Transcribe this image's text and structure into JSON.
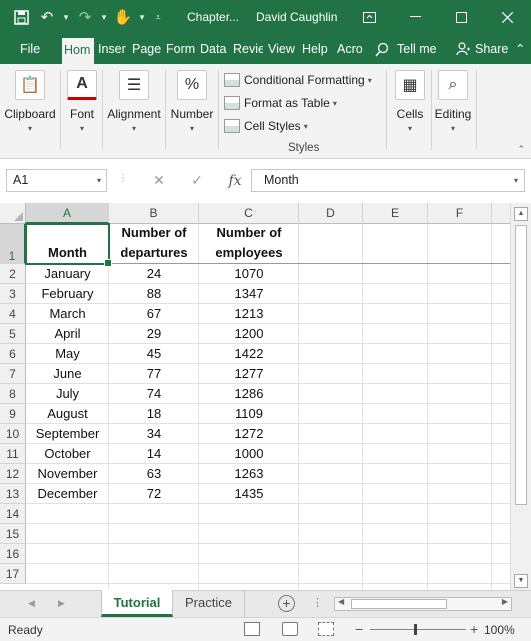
{
  "window": {
    "title": "Chapter...",
    "user": "David Caughlin",
    "ribbon_display_icon": "ribbon-display-icon",
    "minimize_icon": "minimize-icon",
    "maximize_icon": "maximize-icon",
    "close_icon": "close-icon"
  },
  "qat": {
    "save_icon": "save-icon",
    "undo_icon": "undo-icon",
    "redo_icon": "redo-icon",
    "touch_icon": "touch-mode-icon",
    "customize_icon": "customize-qat-icon"
  },
  "tabs": [
    "File",
    "Hom",
    "Inser",
    "Page",
    "Form",
    "Data",
    "Revie",
    "View",
    "Help",
    "Acro"
  ],
  "active_tab": "Hom",
  "tell_me": "Tell me",
  "share": "Share",
  "ribbon": {
    "clipboard": "Clipboard",
    "font": "Font",
    "alignment": "Alignment",
    "number": "Number",
    "conditional_formatting": "Conditional Formatting",
    "format_as_table": "Format as Table",
    "cell_styles": "Cell Styles",
    "styles_group": "Styles",
    "cells": "Cells",
    "editing": "Editing"
  },
  "formula_bar": {
    "name_box": "A1",
    "cancel": "✕",
    "enter": "✓",
    "fx": "fx",
    "content": "Month"
  },
  "columns": [
    "A",
    "B",
    "C",
    "D",
    "E",
    "F"
  ],
  "rows": [
    "1",
    "2",
    "3",
    "4",
    "5",
    "6",
    "7",
    "8",
    "9",
    "10",
    "11",
    "12",
    "13",
    "14",
    "15",
    "16",
    "17"
  ],
  "header_row": {
    "month": "Month",
    "departures": [
      "Number of",
      "departures"
    ],
    "employees": [
      "Number of",
      "employees"
    ]
  },
  "table": [
    [
      "January",
      "24",
      "1070"
    ],
    [
      "February",
      "88",
      "1347"
    ],
    [
      "March",
      "67",
      "1213"
    ],
    [
      "April",
      "29",
      "1200"
    ],
    [
      "May",
      "45",
      "1422"
    ],
    [
      "June",
      "77",
      "1277"
    ],
    [
      "July",
      "74",
      "1286"
    ],
    [
      "August",
      "18",
      "1109"
    ],
    [
      "September",
      "34",
      "1272"
    ],
    [
      "October",
      "14",
      "1000"
    ],
    [
      "November",
      "63",
      "1263"
    ],
    [
      "December",
      "72",
      "1435"
    ]
  ],
  "sheets": [
    "Tutorial",
    "Practice"
  ],
  "active_sheet": "Tutorial",
  "status": {
    "ready": "Ready",
    "zoom": "100%",
    "zoom_minus": "−",
    "zoom_plus": "+"
  },
  "colors": {
    "accent": "#217346",
    "ribbon_bg": "#f3f3f3"
  }
}
